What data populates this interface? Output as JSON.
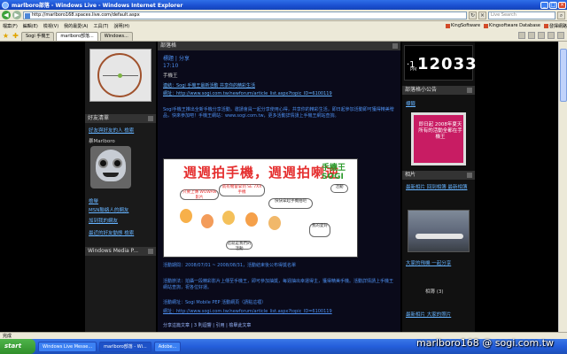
{
  "window": {
    "title": "marlboro部落 - Windows Live - Windows Internet Explorer"
  },
  "address": {
    "url": "http://marlboro168.spaces.live.com/default.aspx",
    "search_placeholder": "Live Search"
  },
  "menubar": {
    "items": [
      "檔案(F)",
      "編輯(E)",
      "檢視(V)",
      "我的最愛(A)",
      "工具(T)",
      "說明(H)"
    ],
    "links": [
      "KingSoftware",
      "Kingsoftware Database",
      "發揮網路"
    ]
  },
  "tabs": [
    {
      "label": "Sogi 手機王"
    },
    {
      "label": "marlboro部落..."
    },
    {
      "label": "Windows..."
    }
  ],
  "left": {
    "friends_header": "好友清單",
    "friends_link": "好友與好友的人 檢索",
    "owner_label": "暴Marlboro",
    "links": [
      "檢舉",
      "MSN聯絡人的網友",
      "加到我的網友"
    ],
    "recent_link": "最近的好友動態 檢索",
    "wmp_header": "Windows Media P..."
  },
  "center": {
    "header": "部落格",
    "meta1": "標題 | 分享",
    "meta2": "17:10",
    "meta3": "手機王",
    "link_line1": "連結：Sogi 手機王最新活動 共享你的精彩生活",
    "link_line2": "網址：http://www.sogi.com.tw/newforum/article_list.aspx?topic_ID=6100119",
    "body1": "Sogi手機王推出全新手機分享活動，邀請會員一起分享使用心得，共享你的精彩生活，即日起參加活動即可獲得精美贈品，快來參加吧！手機王網站：www.sogi.com.tw，更多活動詳情請上手機王網站查詢。",
    "banner_title": "週週拍手機，週週拍喇逆",
    "banner_logo": "手機王 SOGI",
    "bubble1": "只要上傳 WOWAN 影片",
    "bubble2": "就有機會拿到 SE 7XX 手機",
    "bubble3": "快快拿起手機拍吧",
    "bubble4": "這就是我們的活動",
    "bubble5": "我的愛好",
    "bubble6": "活動",
    "body2": "活動期間：2008/07/01 ~ 2008/08/31，活動結束後公布得獎名單",
    "body3": "活動辦法：拍攝一段精彩影片上傳至手機王，即可參加抽獎，每週抽出幸運得主，獲得精美手機。活動詳情請上手機王網站查詢，祝各位好運。",
    "body4": "活動網址：Sogi Mobile PEP 活動網頁（請點這裡）",
    "body5": "網址：http://www.sogi.com.tw/newforum/article_list.aspx?topic_ID=6100119",
    "footer_line": "分享這篇文章 | 3 則迴響 | 引用 | 檢舉此文章"
  },
  "right": {
    "clock": {
      "time": "12033",
      "prefix": "·1",
      "ampm": "PM"
    },
    "notice_header": "部落格小公告",
    "notice_link": "標籤",
    "notice_text": "即日起 2008年夏天所有的活動全都在手機王",
    "photos_header": "相片",
    "photos_links": "最新相片 回到相簿 最新相簿",
    "photo_caption": "大家的飛機 一起分享",
    "photo_count": "相簿 (3)",
    "recent_link": "最新相片 大家的照片"
  },
  "statusbar": {
    "text": "完成"
  },
  "taskbar": {
    "start": "start",
    "tasks": [
      "Windows Live Messe...",
      "marlboro部落 - Wi...",
      "Adobe..."
    ]
  },
  "watermark": "marlboro168 @ sogi.com.tw"
}
